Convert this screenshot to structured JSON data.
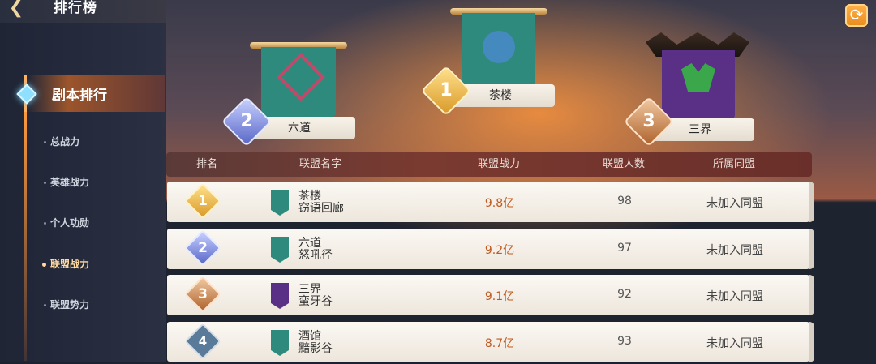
{
  "header": {
    "title": "排行榜",
    "back_icon": "back-arrow-icon",
    "refresh_icon": "refresh-icon"
  },
  "sidebar": {
    "section_label": "剧本排行",
    "items": [
      {
        "label": "总战力",
        "selected": false
      },
      {
        "label": "英雄战力",
        "selected": false
      },
      {
        "label": "个人功勋",
        "selected": false
      },
      {
        "label": "联盟战力",
        "selected": true
      },
      {
        "label": "联盟势力",
        "selected": false
      }
    ]
  },
  "podium": {
    "first": {
      "rank": "1",
      "name": "茶楼",
      "banner_color": "#2f8a7e"
    },
    "second": {
      "rank": "2",
      "name": "六道",
      "banner_color": "#2f8a7e"
    },
    "third": {
      "rank": "3",
      "name": "三界",
      "banner_color": "#5a2f86"
    }
  },
  "table": {
    "headers": {
      "rank": "排名",
      "name": "联盟名字",
      "power": "联盟战力",
      "members": "联盟人数",
      "league": "所属同盟"
    },
    "rows": [
      {
        "rank": "1",
        "name": "茶楼",
        "sub": "窃语回廊",
        "power": "9.8亿",
        "members": "98",
        "league": "未加入同盟",
        "banner_color": "#2f8a7e"
      },
      {
        "rank": "2",
        "name": "六道",
        "sub": "怒吼径",
        "power": "9.2亿",
        "members": "97",
        "league": "未加入同盟",
        "banner_color": "#2f8a7e"
      },
      {
        "rank": "3",
        "name": "三界",
        "sub": "蛮牙谷",
        "power": "9.1亿",
        "members": "92",
        "league": "未加入同盟",
        "banner_color": "#5a2f86"
      },
      {
        "rank": "4",
        "name": "酒馆",
        "sub": "黯影谷",
        "power": "8.7亿",
        "members": "93",
        "league": "未加入同盟",
        "banner_color": "#2f8a7e"
      }
    ]
  },
  "colors": {
    "gold": "#e8b040",
    "silver": "#7a88d8",
    "bronze": "#c87a3c",
    "plain": "#5a7a9a"
  }
}
